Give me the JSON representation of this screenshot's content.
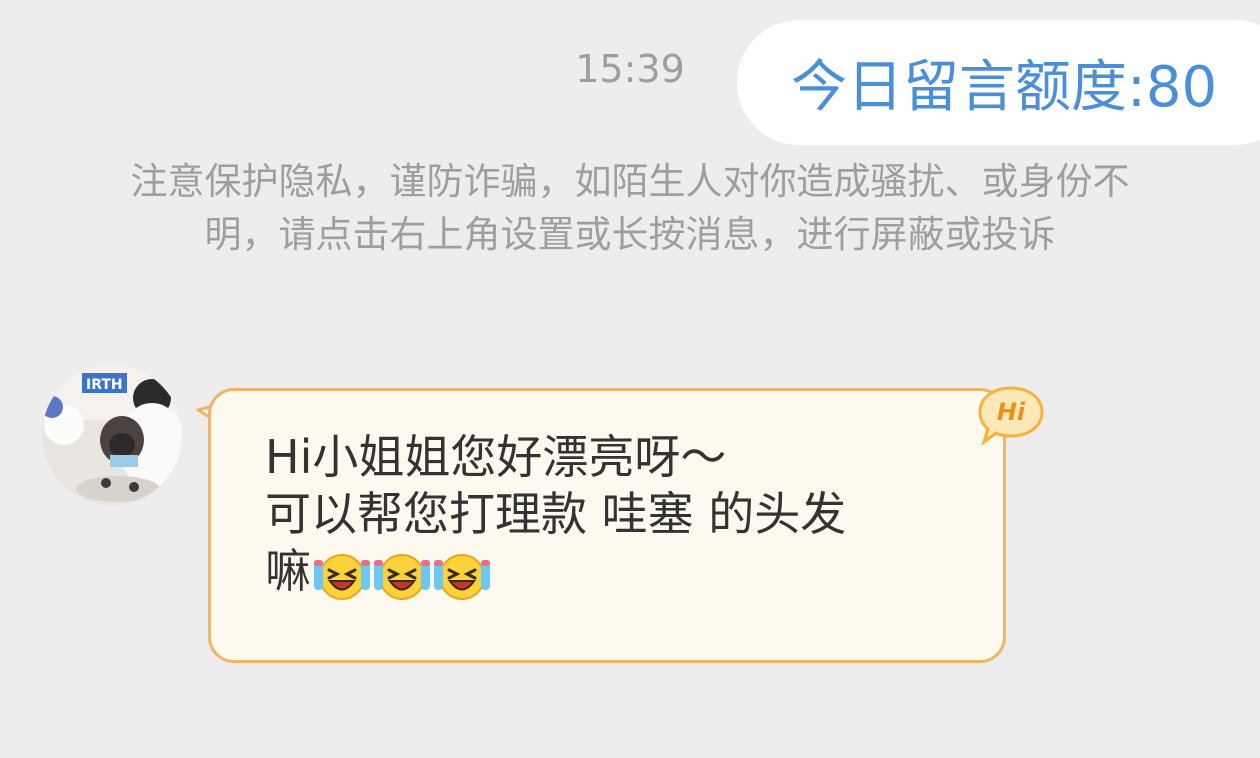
{
  "chat": {
    "timestamp": "15:39",
    "quota_label": "今日留言额度:80",
    "privacy_notice": "注意保护隐私，谨防诈骗，如陌生人对你造成骚扰、或身份不明，请点击右上角设置或长按消息，进行屏蔽或投诉",
    "message": {
      "lines": [
        "Hi小姐姐您好漂亮呀～",
        "可以帮您打理款 哇塞 的头发",
        "嘛"
      ],
      "emoji": "laugh-cry-emoji",
      "emoji_count": 3,
      "badge_label": "Hi"
    },
    "colors": {
      "background": "#ededed",
      "quota_text": "#4a90d9",
      "bubble_fill": "#fef9ee",
      "bubble_border": "#f1b56a",
      "badge_fill": "#f7b13c",
      "muted_text": "#9e9e9e"
    }
  }
}
